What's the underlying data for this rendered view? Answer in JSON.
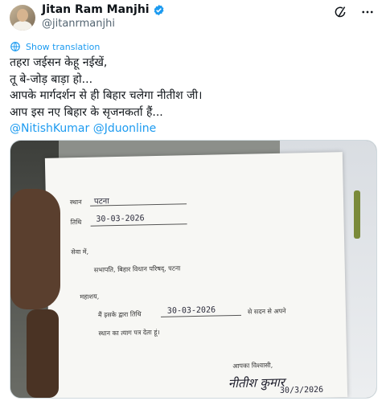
{
  "author": {
    "name": "Jitan Ram Manjhi",
    "handle": "@jitanrmanjhi"
  },
  "actions": {
    "translate_label": "Show translation"
  },
  "tweet": {
    "lines": [
      "तहरा जईसन केहू नईखें,",
      "तू बे-जोड़ बाड़ा हो...",
      "आपके मार्गदर्शन से ही बिहार चलेगा नीतीश जी।",
      "आप इस नए बिहार के सृजनकर्ता हैं..."
    ],
    "mentions": "@NitishKumar @Jduonline"
  },
  "document": {
    "place_label": "स्थान",
    "place_value": "पटना",
    "date_label": "तिथि",
    "date_value": "30-03-2026",
    "to_line": "सेवा में,",
    "addressee": "सभापति, बिहार विधान परिषद्, पटना",
    "salutation": "महाशय,",
    "body_1": "मैं इसके द्वारा तिथि",
    "body_date": "30-03-2026",
    "body_2": "से सदन से अपने",
    "body_3": "स्थान का त्याग पत्र देता हूं।",
    "closing": "आपका विश्वासी,",
    "signature": "नीतीश कुमार",
    "sign_date": "30/3/2026"
  }
}
